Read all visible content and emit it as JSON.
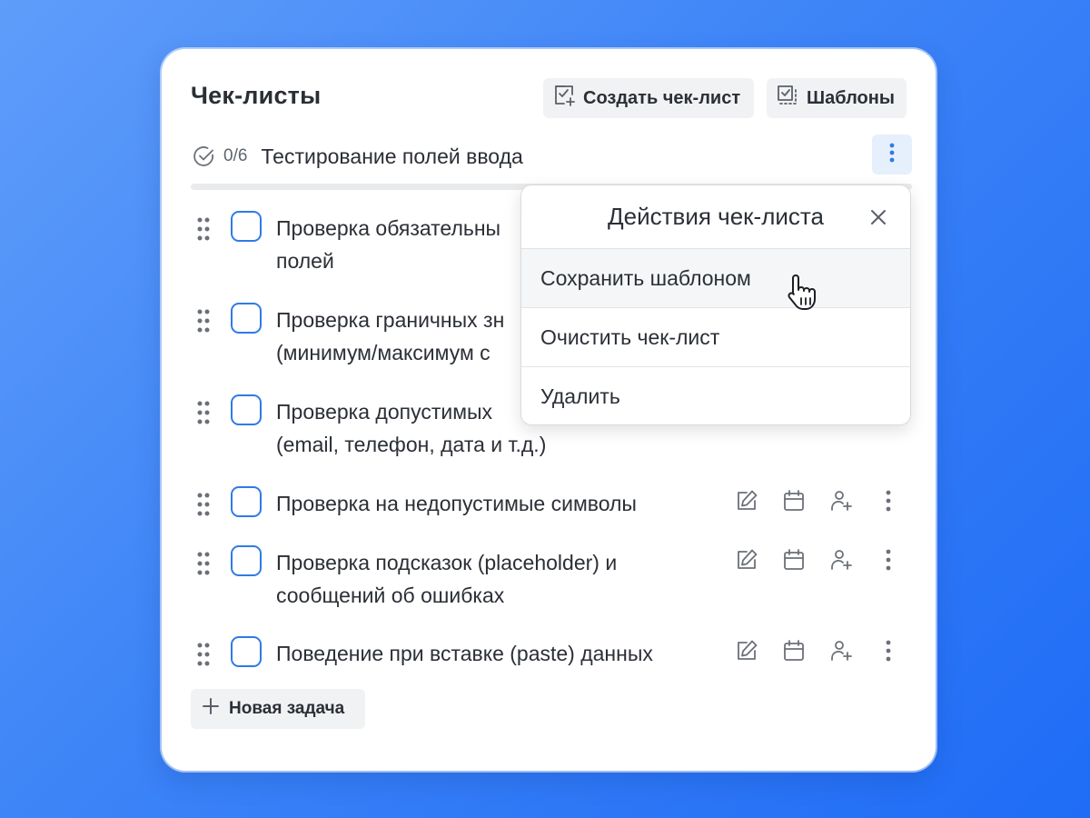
{
  "header": {
    "title": "Чек-листы",
    "create_button": "Создать чек-лист",
    "templates_button": "Шаблоны"
  },
  "checklist": {
    "progress": "0/6",
    "progress_fraction": 0,
    "name": "Тестирование полей ввода"
  },
  "tasks": [
    {
      "line1": "Проверка обязательны",
      "line2": "полей",
      "checked": false
    },
    {
      "line1": "Проверка граничных зн",
      "line2": "(минимум/максимум с",
      "checked": false
    },
    {
      "line1": "Проверка допустимых ",
      "line2": "(email, телефон, дата и т.д.)",
      "checked": false
    },
    {
      "line1": "Проверка на недопустимые символы",
      "line2": "",
      "checked": false
    },
    {
      "line1": "Проверка подсказок (placeholder) и",
      "line2": "сообщений об ошибках",
      "checked": false
    },
    {
      "line1": "Поведение при вставке (paste) данных",
      "line2": "",
      "checked": false
    }
  ],
  "add_task_label": "Новая задача",
  "popup": {
    "title": "Действия чек-листа",
    "items": [
      "Сохранить шаблоном",
      "Очистить чек-лист",
      "Удалить"
    ],
    "hovered_item": "Сохранить шаблоном"
  },
  "icons": {
    "create": "checklist-add-icon",
    "templates": "template-icon",
    "status": "check-circle-icon",
    "more": "more-vertical-icon",
    "drag": "drag-handle-icon",
    "edit": "edit-icon",
    "calendar": "calendar-icon",
    "assign": "assign-user-icon",
    "add": "plus-icon",
    "close": "close-icon",
    "cursor": "hand-pointer-icon"
  },
  "colors": {
    "accent": "#2f7be6",
    "more_button_bg": "#e6f0fd",
    "background_start": "#5f9dfa",
    "background_end": "#1f6cf6"
  }
}
